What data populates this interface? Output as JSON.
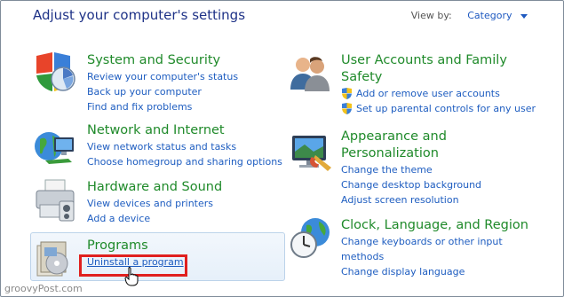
{
  "header": {
    "title": "Adjust your computer's settings",
    "view_by_label": "View by:",
    "view_by_value": "Category"
  },
  "categories": [
    {
      "title": "System and Security",
      "links": [
        "Review your computer's status",
        "Back up your computer",
        "Find and fix problems"
      ]
    },
    {
      "title": "Network and Internet",
      "links": [
        "View network status and tasks",
        "Choose homegroup and sharing options"
      ]
    },
    {
      "title": "Hardware and Sound",
      "links": [
        "View devices and printers",
        "Add a device"
      ]
    },
    {
      "title": "Programs",
      "links": [
        "Uninstall a program"
      ]
    },
    {
      "title_line1": "User Accounts and Family",
      "title_line2": "Safety",
      "links": [
        "Add or remove user accounts",
        "Set up parental controls for any user"
      ]
    },
    {
      "title_line1": "Appearance and",
      "title_line2": "Personalization",
      "links": [
        "Change the theme",
        "Change desktop background",
        "Adjust screen resolution"
      ]
    },
    {
      "title": "Clock, Language, and Region",
      "links": [
        "Change keyboards or other input",
        "methods",
        "Change display language"
      ]
    }
  ],
  "watermark": "groovyPost.com",
  "colors": {
    "header_text": "#1e3287",
    "category_title": "#1f8a2a",
    "link": "#1e5dc0",
    "highlight_box": "#e0201e"
  }
}
